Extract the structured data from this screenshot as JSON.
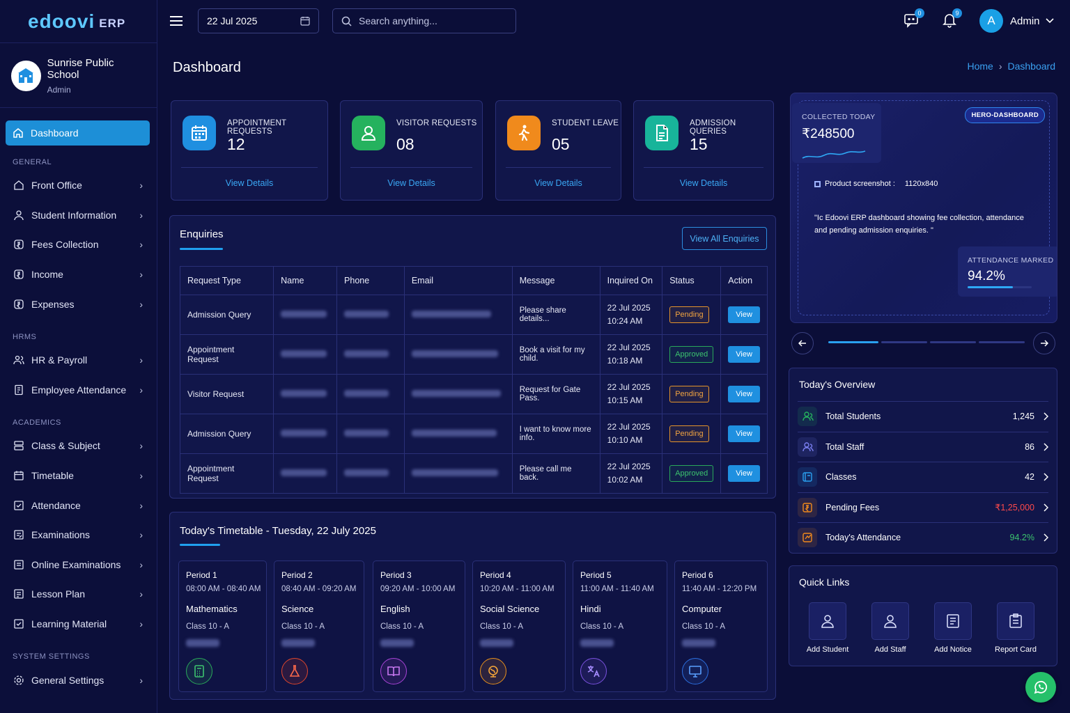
{
  "brand": {
    "name": "edoovi",
    "suffix": "ERP"
  },
  "school": {
    "name": "Sunrise Public School",
    "role": "Admin"
  },
  "sidebar": {
    "active": "Dashboard",
    "sections": [
      {
        "title": "GENERAL",
        "items": [
          "Front Office",
          "Student Information",
          "Fees Collection",
          "Income",
          "Expenses"
        ]
      },
      {
        "title": "HRMS",
        "items": [
          "HR & Payroll",
          "Employee Attendance"
        ]
      },
      {
        "title": "ACADEMICS",
        "items": [
          "Class & Subject",
          "Timetable",
          "Attendance",
          "Examinations",
          "Online Examinations",
          "Lesson Plan",
          "Learning Material"
        ]
      },
      {
        "title": "SYSTEM SETTINGS",
        "items": [
          "General Settings"
        ]
      }
    ]
  },
  "topbar": {
    "date": "22 Jul 2025",
    "search_placeholder": "Search anything...",
    "messages_count": "0",
    "notifications_count": "9",
    "user_initial": "A",
    "user_name": "Admin"
  },
  "page": {
    "title": "Dashboard",
    "breadcrumb": [
      "Home",
      "Dashboard"
    ]
  },
  "stats": [
    {
      "label": "APPOINTMENT REQUESTS",
      "value": "12",
      "link": "View Details",
      "color": "#1f8fe0",
      "icon": "calendar-icon"
    },
    {
      "label": "VISITOR REQUESTS",
      "value": "08",
      "link": "View Details",
      "color": "#25b25e",
      "icon": "user-icon"
    },
    {
      "label": "STUDENT LEAVE",
      "value": "05",
      "link": "View Details",
      "color": "#f08a1c",
      "icon": "walking-icon"
    },
    {
      "label": "ADMISSION QUERIES",
      "value": "15",
      "link": "View Details",
      "color": "#18b49a",
      "icon": "document-icon"
    }
  ],
  "enquiries": {
    "title": "Enquiries",
    "button": "View All Enquiries",
    "columns": [
      "Request Type",
      "Name",
      "Phone",
      "Email",
      "Message",
      "Inquired On",
      "Status",
      "Action"
    ],
    "rows": [
      {
        "type": "Admission Query",
        "message": "Please share details...",
        "date": "22 Jul 2025",
        "time": "10:24 AM",
        "status": "Pending",
        "action": "View"
      },
      {
        "type": "Appointment Request",
        "message": "Book a visit for my child.",
        "date": "22 Jul 2025",
        "time": "10:18 AM",
        "status": "Approved",
        "action": "View"
      },
      {
        "type": "Visitor Request",
        "message": "Request for Gate Pass.",
        "date": "22 Jul 2025",
        "time": "10:15 AM",
        "status": "Pending",
        "action": "View"
      },
      {
        "type": "Admission Query",
        "message": "I want to know more info.",
        "date": "22 Jul 2025",
        "time": "10:10 AM",
        "status": "Pending",
        "action": "View"
      },
      {
        "type": "Appointment Request",
        "message": "Please call me back.",
        "date": "22 Jul 2025",
        "time": "10:02 AM",
        "status": "Approved",
        "action": "View"
      }
    ]
  },
  "timetable": {
    "title": "Today's Timetable - Tuesday, 22 July 2025",
    "periods": [
      {
        "name": "Period 1",
        "time": "08:00 AM - 08:40 AM",
        "subject": "Mathematics",
        "class": "Class 10 - A",
        "color": "#2aa85a",
        "icon": "calculator-icon"
      },
      {
        "name": "Period 2",
        "time": "08:40 AM - 09:20 AM",
        "subject": "Science",
        "class": "Class 10 - A",
        "color": "#e0462b",
        "icon": "flask-icon"
      },
      {
        "name": "Period 3",
        "time": "09:20 AM - 10:00 AM",
        "subject": "English",
        "class": "Class 10 - A",
        "color": "#a944d8",
        "icon": "book-icon"
      },
      {
        "name": "Period 4",
        "time": "10:20 AM - 11:00 AM",
        "subject": "Social Science",
        "class": "Class 10 - A",
        "color": "#e8901c",
        "icon": "globe-icon"
      },
      {
        "name": "Period 5",
        "time": "11:00 AM - 11:40 AM",
        "subject": "Hindi",
        "class": "Class 10 - A",
        "color": "#7b52e0",
        "icon": "translate-icon"
      },
      {
        "name": "Period 6",
        "time": "11:40 AM - 12:20 PM",
        "subject": "Computer",
        "class": "Class 10 - A",
        "color": "#2c6fe0",
        "icon": "monitor-icon"
      }
    ]
  },
  "hero": {
    "collected_label": "COLLECTED TODAY",
    "collected_value": "₹248500",
    "tag": "HERO-DASHBOARD",
    "screenshot_label": "Product screenshot :",
    "screenshot_size": "1120x840",
    "quote": "\"Ic  Edoovi ERP dashboard showing fee collection, attendance and pending admission enquiries. \"",
    "attendance_label": "ATTENDANCE MARKED",
    "attendance_value": "94.2%",
    "attendance_fraction": 0.942
  },
  "overview": {
    "title": "Today's Overview",
    "rows": [
      {
        "label": "Total Students",
        "value": "1,245",
        "color": "#ffffff",
        "icon": "students-icon",
        "icolor": "#25b25e"
      },
      {
        "label": "Total Staff",
        "value": "86",
        "color": "#ffffff",
        "icon": "staff-icon",
        "icolor": "#7a7ff0"
      },
      {
        "label": "Classes",
        "value": "42",
        "color": "#ffffff",
        "icon": "classes-icon",
        "icolor": "#2aa0f0"
      },
      {
        "label": "Pending Fees",
        "value": "₹1,25,000",
        "color": "#ff4a4a",
        "icon": "fees-icon",
        "icolor": "#f08a1c"
      },
      {
        "label": "Today's Attendance",
        "value": "94.2%",
        "color": "#3cc36e",
        "icon": "attendance-icon",
        "icolor": "#f08a1c"
      }
    ]
  },
  "quick_links": {
    "title": "Quick Links",
    "items": [
      {
        "label": "Add Student",
        "icon": "user-icon"
      },
      {
        "label": "Add Staff",
        "icon": "user-icon"
      },
      {
        "label": "Add Notice",
        "icon": "notice-icon"
      },
      {
        "label": "Report Card",
        "icon": "report-icon"
      }
    ]
  }
}
